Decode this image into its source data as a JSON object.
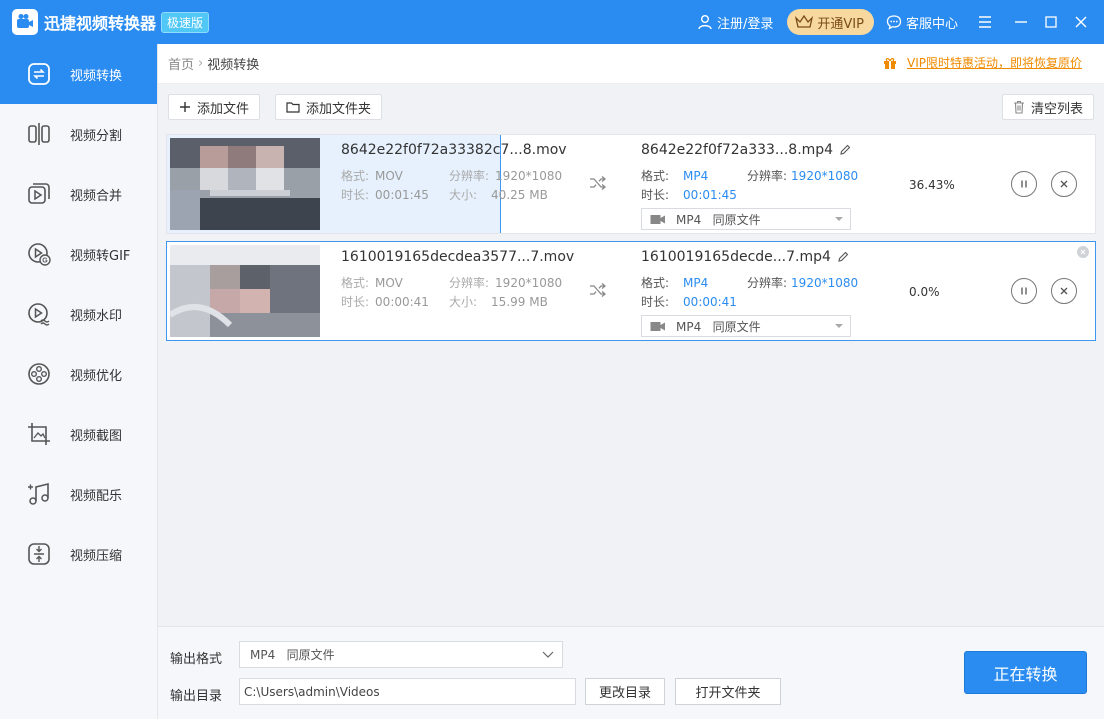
{
  "app": {
    "title": "迅捷视频转换器",
    "badge": "极速版",
    "login": "注册/登录",
    "vip": "开通VIP",
    "support": "客服中心"
  },
  "sidebar": {
    "items": [
      {
        "label": "视频转换",
        "icon": "video-convert-icon",
        "active": true
      },
      {
        "label": "视频分割",
        "icon": "video-split-icon"
      },
      {
        "label": "视频合并",
        "icon": "video-merge-icon"
      },
      {
        "label": "视频转GIF",
        "icon": "video-gif-icon"
      },
      {
        "label": "视频水印",
        "icon": "video-watermark-icon"
      },
      {
        "label": "视频优化",
        "icon": "video-optimize-icon"
      },
      {
        "label": "视频截图",
        "icon": "video-screenshot-icon"
      },
      {
        "label": "视频配乐",
        "icon": "video-music-icon"
      },
      {
        "label": "视频压缩",
        "icon": "video-compress-icon"
      }
    ]
  },
  "breadcrumb": {
    "home": "首页",
    "current": "视频转换"
  },
  "promo": "VIP限时特惠活动，即将恢复原价",
  "toolbar": {
    "add_file": "添加文件",
    "add_folder": "添加文件夹",
    "clear_list": "清空列表"
  },
  "files": [
    {
      "source_name": "8642e22f0f72a33382c7...8.mov",
      "format_label": "格式:",
      "format": "MOV",
      "resolution_label": "分辨率:",
      "resolution": "1920*1080",
      "duration_label": "时长:",
      "duration": "00:01:45",
      "size_label": "大小:",
      "size": "40.25 MB",
      "dest_name": "8642e22f0f72a333...8.mp4",
      "dest_format": "MP4",
      "dest_resolution": "1920*1080",
      "dest_duration": "00:01:45",
      "output_select": "MP4   同原文件",
      "progress": "36.43%"
    },
    {
      "source_name": "1610019165decdea3577...7.mov",
      "format_label": "格式:",
      "format": "MOV",
      "resolution_label": "分辨率:",
      "resolution": "1920*1080",
      "duration_label": "时长:",
      "duration": "00:00:41",
      "size_label": "大小:",
      "size": "15.99 MB",
      "dest_name": "1610019165decde...7.mp4",
      "dest_format": "MP4",
      "dest_resolution": "1920*1080",
      "dest_duration": "00:00:41",
      "output_select": "MP4   同原文件",
      "progress": "0.0%"
    }
  ],
  "bottom": {
    "output_format_label": "输出格式",
    "output_format_value": "MP4   同原文件",
    "output_dir_label": "输出目录",
    "output_dir_value": "C:\\Users\\admin\\Videos",
    "change_dir": "更改目录",
    "open_folder": "打开文件夹",
    "convert_button": "正在转换"
  },
  "colors": {
    "accent": "#2a8cf0",
    "vip_bg": "#f7d9a0",
    "promo": "#f08a00"
  }
}
